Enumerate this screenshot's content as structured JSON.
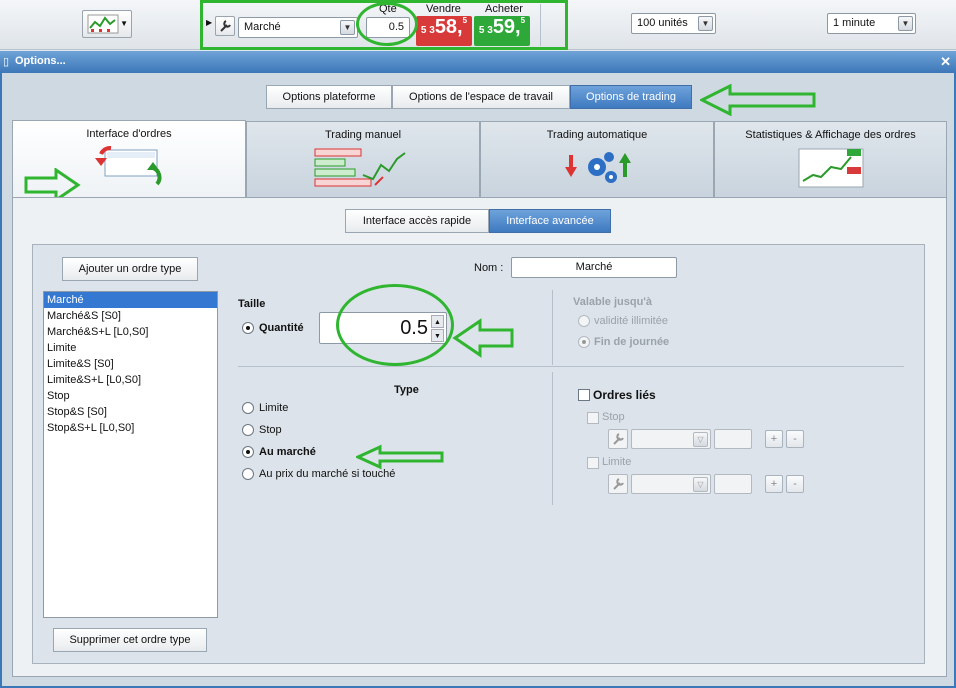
{
  "toolbar": {
    "order_type": "Marché",
    "qty_label": "Qte",
    "qty_value": "0.5",
    "sell_label": "Vendre",
    "buy_label": "Acheter",
    "sell_price": {
      "pre": "5 3",
      "big": "58,",
      "small": "5"
    },
    "buy_price": {
      "pre": "5 3",
      "big": "59,",
      "small": "5"
    },
    "units_value": "100 unités",
    "interval_value": "1 minute"
  },
  "window": {
    "title": "Options...",
    "close": "✕"
  },
  "top_tabs": [
    "Options plateforme",
    "Options de l'espace de travail",
    "Options de trading"
  ],
  "main_tabs": [
    "Interface d'ordres",
    "Trading manuel",
    "Trading automatique",
    "Statistiques & Affichage des ordres"
  ],
  "sub_tabs": [
    "Interface accès rapide",
    "Interface avancée"
  ],
  "left": {
    "add_button": "Ajouter un ordre type",
    "delete_button": "Supprimer cet ordre type",
    "order_types": [
      "Marché",
      "Marché&S [S0]",
      "Marché&S+L [L0,S0]",
      "Limite",
      "Limite&S [S0]",
      "Limite&S+L [L0,S0]",
      "Stop",
      "Stop&S [S0]",
      "Stop&S+L [L0,S0]"
    ]
  },
  "form": {
    "nom_label": "Nom :",
    "nom_value": "Marché",
    "taille_label": "Taille",
    "quantite_label": "Quantité",
    "quantite_value": "0.5",
    "valable_label": "Valable jusqu'à",
    "valid_unlimited": "validité illimitée",
    "valid_end_day": "Fin de journée",
    "type_label": "Type",
    "type_options": [
      "Limite",
      "Stop",
      "Au marché",
      "Au prix du marché si touché"
    ],
    "linked_label": "Ordres liés",
    "stop_label": "Stop",
    "limit_label": "Limite",
    "plus": "+",
    "minus": "-"
  },
  "colors": {
    "accent": "#3f7ac0",
    "annotation": "#2fb52f",
    "sell": "#d83a3a",
    "buy": "#2fa83a"
  }
}
